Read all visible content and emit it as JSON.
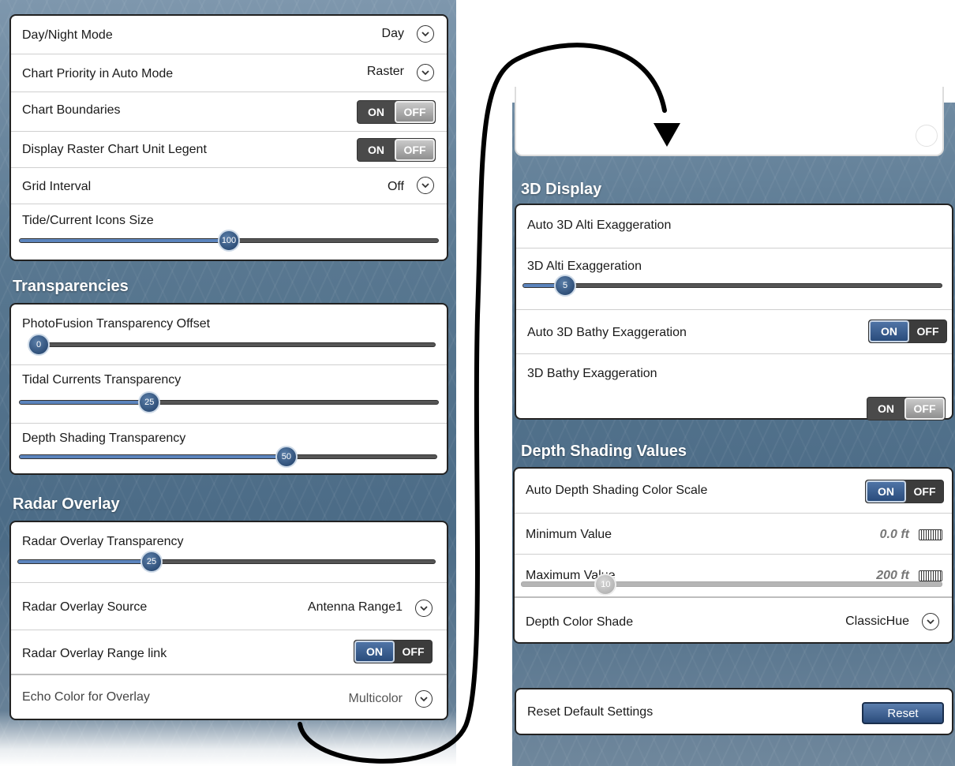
{
  "left": {
    "display": {
      "day_night_label": "Day/Night Mode",
      "day_night_value": "Day",
      "chart_priority_label": "Chart Priority in Auto Mode",
      "chart_priority_value": "Raster",
      "chart_boundaries_label": "Chart Boundaries",
      "chart_boundaries_state": "OFF",
      "raster_unit_label": "Display Raster Chart Unit Legent",
      "raster_unit_state": "OFF",
      "grid_interval_label": "Grid Interval",
      "grid_interval_value": "Off",
      "tide_icons_label": "Tide/Current Icons Size",
      "tide_icons_value": "100"
    },
    "transparencies": {
      "title": "Transparencies",
      "photofusion_label": "PhotoFusion Transparency Offset",
      "photofusion_value": "0",
      "tidal_label": "Tidal Currents Transparency",
      "tidal_value": "25",
      "depth_shading_label": "Depth Shading Transparency",
      "depth_shading_value": "50"
    },
    "radar_overlay": {
      "title": "Radar Overlay",
      "transparency_label": "Radar Overlay Transparency",
      "transparency_value": "25",
      "source_label": "Radar Overlay Source",
      "source_value": "Antenna Range1",
      "range_link_label": "Radar Overlay Range link",
      "range_link_state": "ON",
      "echo_color_label": "Echo Color for Overlay",
      "echo_color_value": "Multicolor"
    }
  },
  "right": {
    "display_3d": {
      "title": "3D Display",
      "auto_alti_label": "Auto 3D Alti Exaggeration",
      "alti_label": "3D Alti Exaggeration",
      "alti_value": "5",
      "auto_bathy_label": "Auto 3D Bathy Exaggeration",
      "auto_bathy_state": "ON",
      "bathy_label": "3D Bathy Exaggeration",
      "bathy_state": "OFF"
    },
    "depth_shading": {
      "title": "Depth Shading Values",
      "auto_scale_label": "Auto Depth Shading Color Scale",
      "auto_scale_state": "ON",
      "min_label": "Minimum Value",
      "min_value": "0.0 ft",
      "max_label": "Maximum Value",
      "max_value": "200 ft",
      "max_slider_value": "10",
      "color_shade_label": "Depth Color Shade",
      "color_shade_value": "ClassicHue"
    },
    "reset": {
      "label": "Reset Default Settings",
      "button": "Reset"
    }
  },
  "toggle_text": {
    "on": "ON",
    "off": "OFF"
  },
  "icons": {
    "dropdown": "chevron-down-icon",
    "keyboard": "keyboard-icon",
    "flow_arrow": "curved-arrow-icon"
  },
  "colors": {
    "slider_fill": "#5b84bd",
    "toggle_on": "#2a4c7c",
    "panel_bg": "#587790"
  },
  "sliders": {
    "tide_icons": 0.5,
    "photofusion": 0.0,
    "tidal": 0.31,
    "depth_shading": 0.64,
    "radar_transparency": 0.32,
    "alti": 0.1,
    "max_value": 0.2
  }
}
